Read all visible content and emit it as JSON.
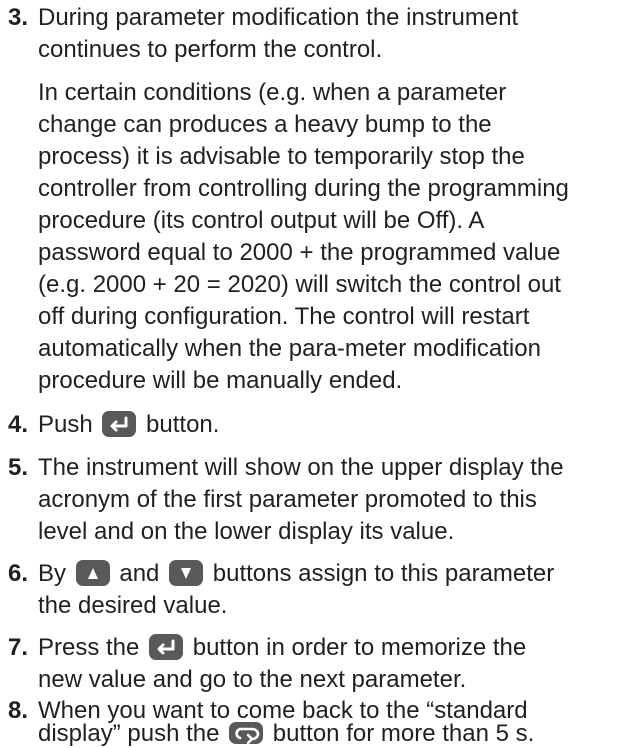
{
  "steps": [
    {
      "number": "3.",
      "line1": "During parameter modification the instrument",
      "line2": "continues to perform the control.",
      "note": [
        "In certain conditions (e.g. when a parameter",
        "change can produces a heavy bump to the",
        "process) it is advisable to temporarily stop the",
        "controller from controlling during the programming",
        "procedure (its control output will be Off). A",
        "password equal to 2000 + the programmed value",
        "(e.g. 2000 + 20 = 2020) will switch the control out",
        "off during configuration.  The control will restart",
        "automatically when the para-meter modification",
        "procedure will be manually ended."
      ]
    },
    {
      "number": "4.",
      "before": "Push",
      "after": "button."
    },
    {
      "number": "5.",
      "line1": "The instrument will show on the upper display the",
      "line2": "acronym of the first parameter promoted to this",
      "line3": "level and on the lower display its value."
    },
    {
      "number": "6.",
      "before": "By",
      "mid": "and",
      "after": "buttons assign to this parameter",
      "line2": "the desired value."
    },
    {
      "number": "7.",
      "before": "Press the",
      "after": "button in order to memorize the",
      "line2": "new value and go to the next parameter."
    },
    {
      "number": "8.",
      "line1": "When you want to come back to the “standard",
      "before2": "display” push the",
      "after2": "button for more than 5 s."
    }
  ],
  "icons": {
    "enter": "enter-key-icon",
    "up": "up-arrow-key-icon",
    "down": "down-arrow-key-icon",
    "loop": "exit-loop-key-icon"
  },
  "colors": {
    "text": "#231f20",
    "button": "#58595b"
  }
}
